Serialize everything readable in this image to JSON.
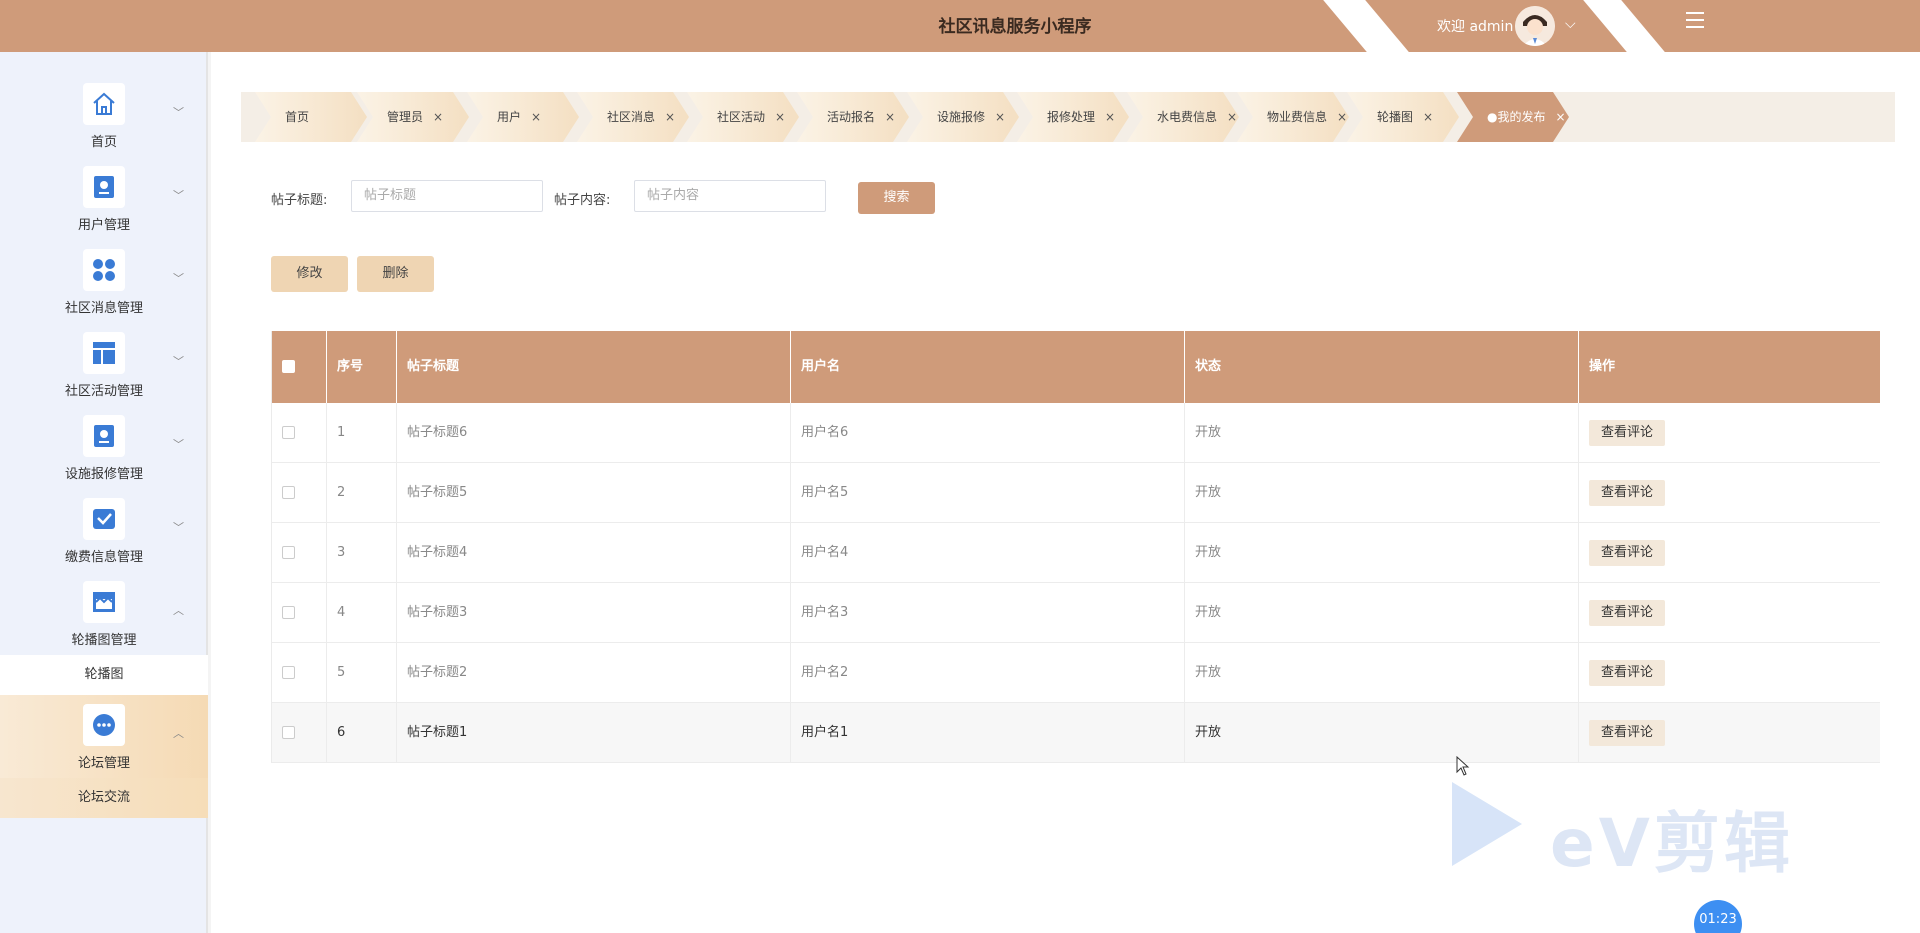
{
  "header": {
    "title": "社区讯息服务小程序",
    "welcome": "欢迎 admin",
    "avatar_icon": "user-avatar-icon",
    "dropdown_icon": "chevron-down-icon",
    "menu_icon": "menu-toggle-icon"
  },
  "sidebar": {
    "items": [
      {
        "label": "首页",
        "icon": "home-icon"
      },
      {
        "label": "用户管理",
        "icon": "user-card-icon"
      },
      {
        "label": "社区消息管理",
        "icon": "grid-icon"
      },
      {
        "label": "社区活动管理",
        "icon": "layout-icon"
      },
      {
        "label": "设施报修管理",
        "icon": "user-card-icon"
      },
      {
        "label": "缴费信息管理",
        "icon": "mail-check-icon"
      },
      {
        "label": "轮播图管理",
        "icon": "storefront-icon"
      },
      {
        "label": "论坛管理",
        "icon": "forum-icon"
      }
    ],
    "sub_carousel": "轮播图",
    "sub_forum": "论坛交流"
  },
  "tabs": [
    {
      "label": "首页"
    },
    {
      "label": "管理员"
    },
    {
      "label": "用户"
    },
    {
      "label": "社区消息"
    },
    {
      "label": "社区活动"
    },
    {
      "label": "活动报名"
    },
    {
      "label": "设施报修"
    },
    {
      "label": "报修处理"
    },
    {
      "label": "水电费信息"
    },
    {
      "label": "物业费信息"
    },
    {
      "label": "轮播图"
    },
    {
      "label": "●我的发布"
    }
  ],
  "close_glyph": "×",
  "search": {
    "title_label": "帖子标题:",
    "title_placeholder": "帖子标题",
    "content_label": "帖子内容:",
    "content_placeholder": "帖子内容",
    "search_button": "搜索"
  },
  "actions": {
    "edit": "修改",
    "delete": "删除"
  },
  "table": {
    "columns": [
      "序号",
      "帖子标题",
      "用户名",
      "状态",
      "操作"
    ],
    "rows": [
      {
        "index": "1",
        "title": "帖子标题6",
        "user": "用户名6",
        "status": "开放",
        "action": "查看评论"
      },
      {
        "index": "2",
        "title": "帖子标题5",
        "user": "用户名5",
        "status": "开放",
        "action": "查看评论"
      },
      {
        "index": "3",
        "title": "帖子标题4",
        "user": "用户名4",
        "status": "开放",
        "action": "查看评论"
      },
      {
        "index": "4",
        "title": "帖子标题3",
        "user": "用户名3",
        "status": "开放",
        "action": "查看评论"
      },
      {
        "index": "5",
        "title": "帖子标题2",
        "user": "用户名2",
        "status": "开放",
        "action": "查看评论"
      },
      {
        "index": "6",
        "title": "帖子标题1",
        "user": "用户名1",
        "status": "开放",
        "action": "查看评论"
      }
    ]
  },
  "overlay": {
    "watermark": "eV剪辑",
    "timer": "01:23"
  },
  "colors": {
    "accent": "#cf9b7a",
    "sidebar_bg": "#eef2fb",
    "button_light": "#efd5b3"
  }
}
